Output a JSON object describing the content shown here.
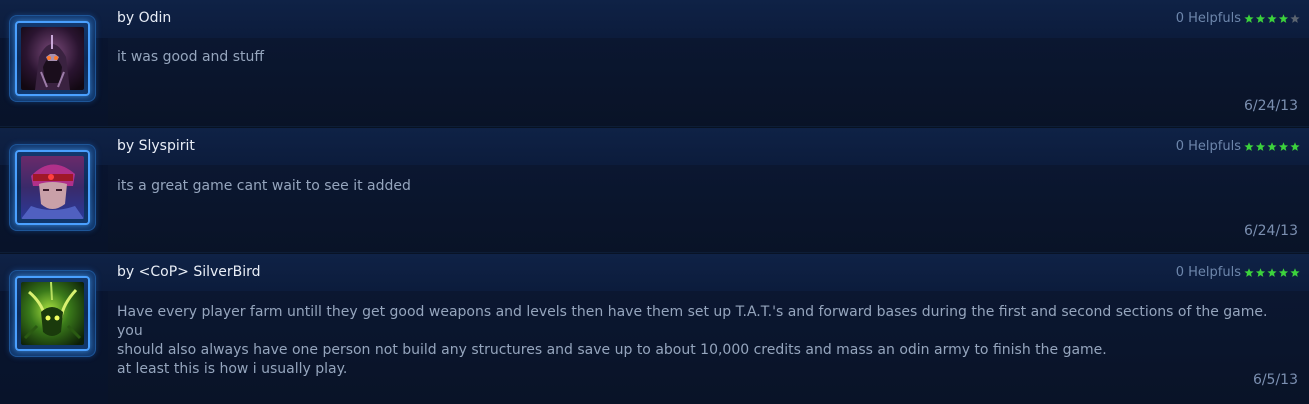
{
  "reviews": [
    {
      "author": "by Odin",
      "helpfuls": "0 Helpfuls",
      "rating": 4,
      "max_rating": 5,
      "comment": "it was good and stuff",
      "date": "6/24/13",
      "avatar": "hooded-purple-warrior-portrait"
    },
    {
      "author": "by Slyspirit",
      "helpfuls": "0 Helpfuls",
      "rating": 5,
      "max_rating": 5,
      "comment": "its a great game cant wait to see it added",
      "date": "6/24/13",
      "avatar": "red-headband-ghost-portrait"
    },
    {
      "author": "by <CoP> SilverBird",
      "helpfuls": "0 Helpfuls",
      "rating": 5,
      "max_rating": 5,
      "comment": "Have every player farm untill they get good weapons and levels then have them set up T.A.T.'s and forward bases during the first and second sections of the game. you\nshould also always have one person not build any structures and save up to about 10,000 credits and mass an odin army to finish the game.\nat least this is how i usually play.",
      "date": "6/5/13",
      "avatar": "green-zerg-portrait"
    }
  ],
  "colors": {
    "star_filled": "#3cd23c",
    "star_empty": "#5b6470",
    "portrait_glow": "#4aa0ff"
  }
}
